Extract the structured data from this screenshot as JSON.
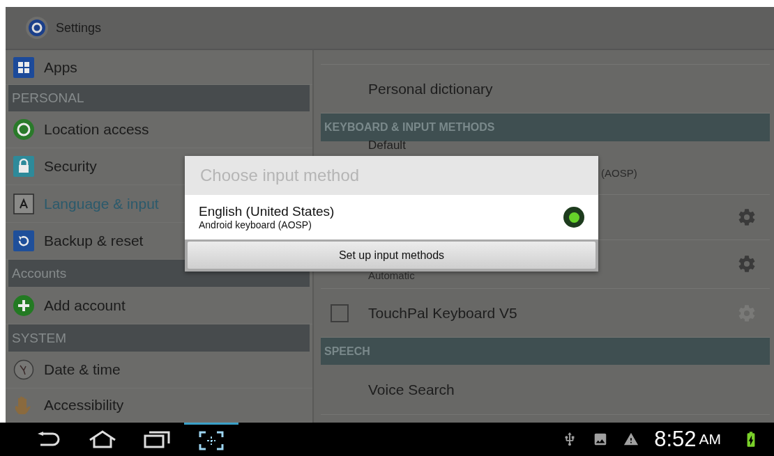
{
  "action_bar": {
    "title": "Settings"
  },
  "sidebar": {
    "sections": [
      {
        "items": [
          {
            "label": "Apps",
            "selected": false
          }
        ]
      },
      {
        "header": "PERSONAL",
        "items": [
          {
            "label": "Location access",
            "selected": false
          },
          {
            "label": "Security",
            "selected": false
          },
          {
            "label": "Language & input",
            "selected": true
          },
          {
            "label": "Backup & reset",
            "selected": false
          }
        ]
      },
      {
        "header": "Accounts",
        "items": [
          {
            "label": "Add account",
            "selected": false
          }
        ]
      },
      {
        "header": "SYSTEM",
        "items": [
          {
            "label": "Date & time",
            "selected": false
          },
          {
            "label": "Accessibility",
            "selected": false
          }
        ]
      }
    ]
  },
  "content": {
    "rows": [
      {
        "kind": "plain",
        "title": "Personal dictionary"
      },
      {
        "kind": "header",
        "title": "KEYBOARD & INPUT METHODS"
      },
      {
        "kind": "default",
        "title": "Default",
        "subtitle": "(AOSP)"
      },
      {
        "kind": "gear",
        "settings_disabled": false
      },
      {
        "kind": "gear",
        "subtitle": "Automatic",
        "settings_disabled": false
      },
      {
        "kind": "checkbox",
        "title": "TouchPal Keyboard V5",
        "checked": false,
        "settings_disabled": true
      },
      {
        "kind": "header",
        "title": "SPEECH"
      },
      {
        "kind": "plain",
        "title": "Voice Search"
      }
    ]
  },
  "dialog": {
    "title": "Choose input method",
    "options": [
      {
        "label": "English (United States)",
        "sublabel": "Android keyboard (AOSP)",
        "selected": true
      }
    ],
    "button": "Set up input methods"
  },
  "status_bar": {
    "time": "8:52",
    "period": "AM"
  }
}
